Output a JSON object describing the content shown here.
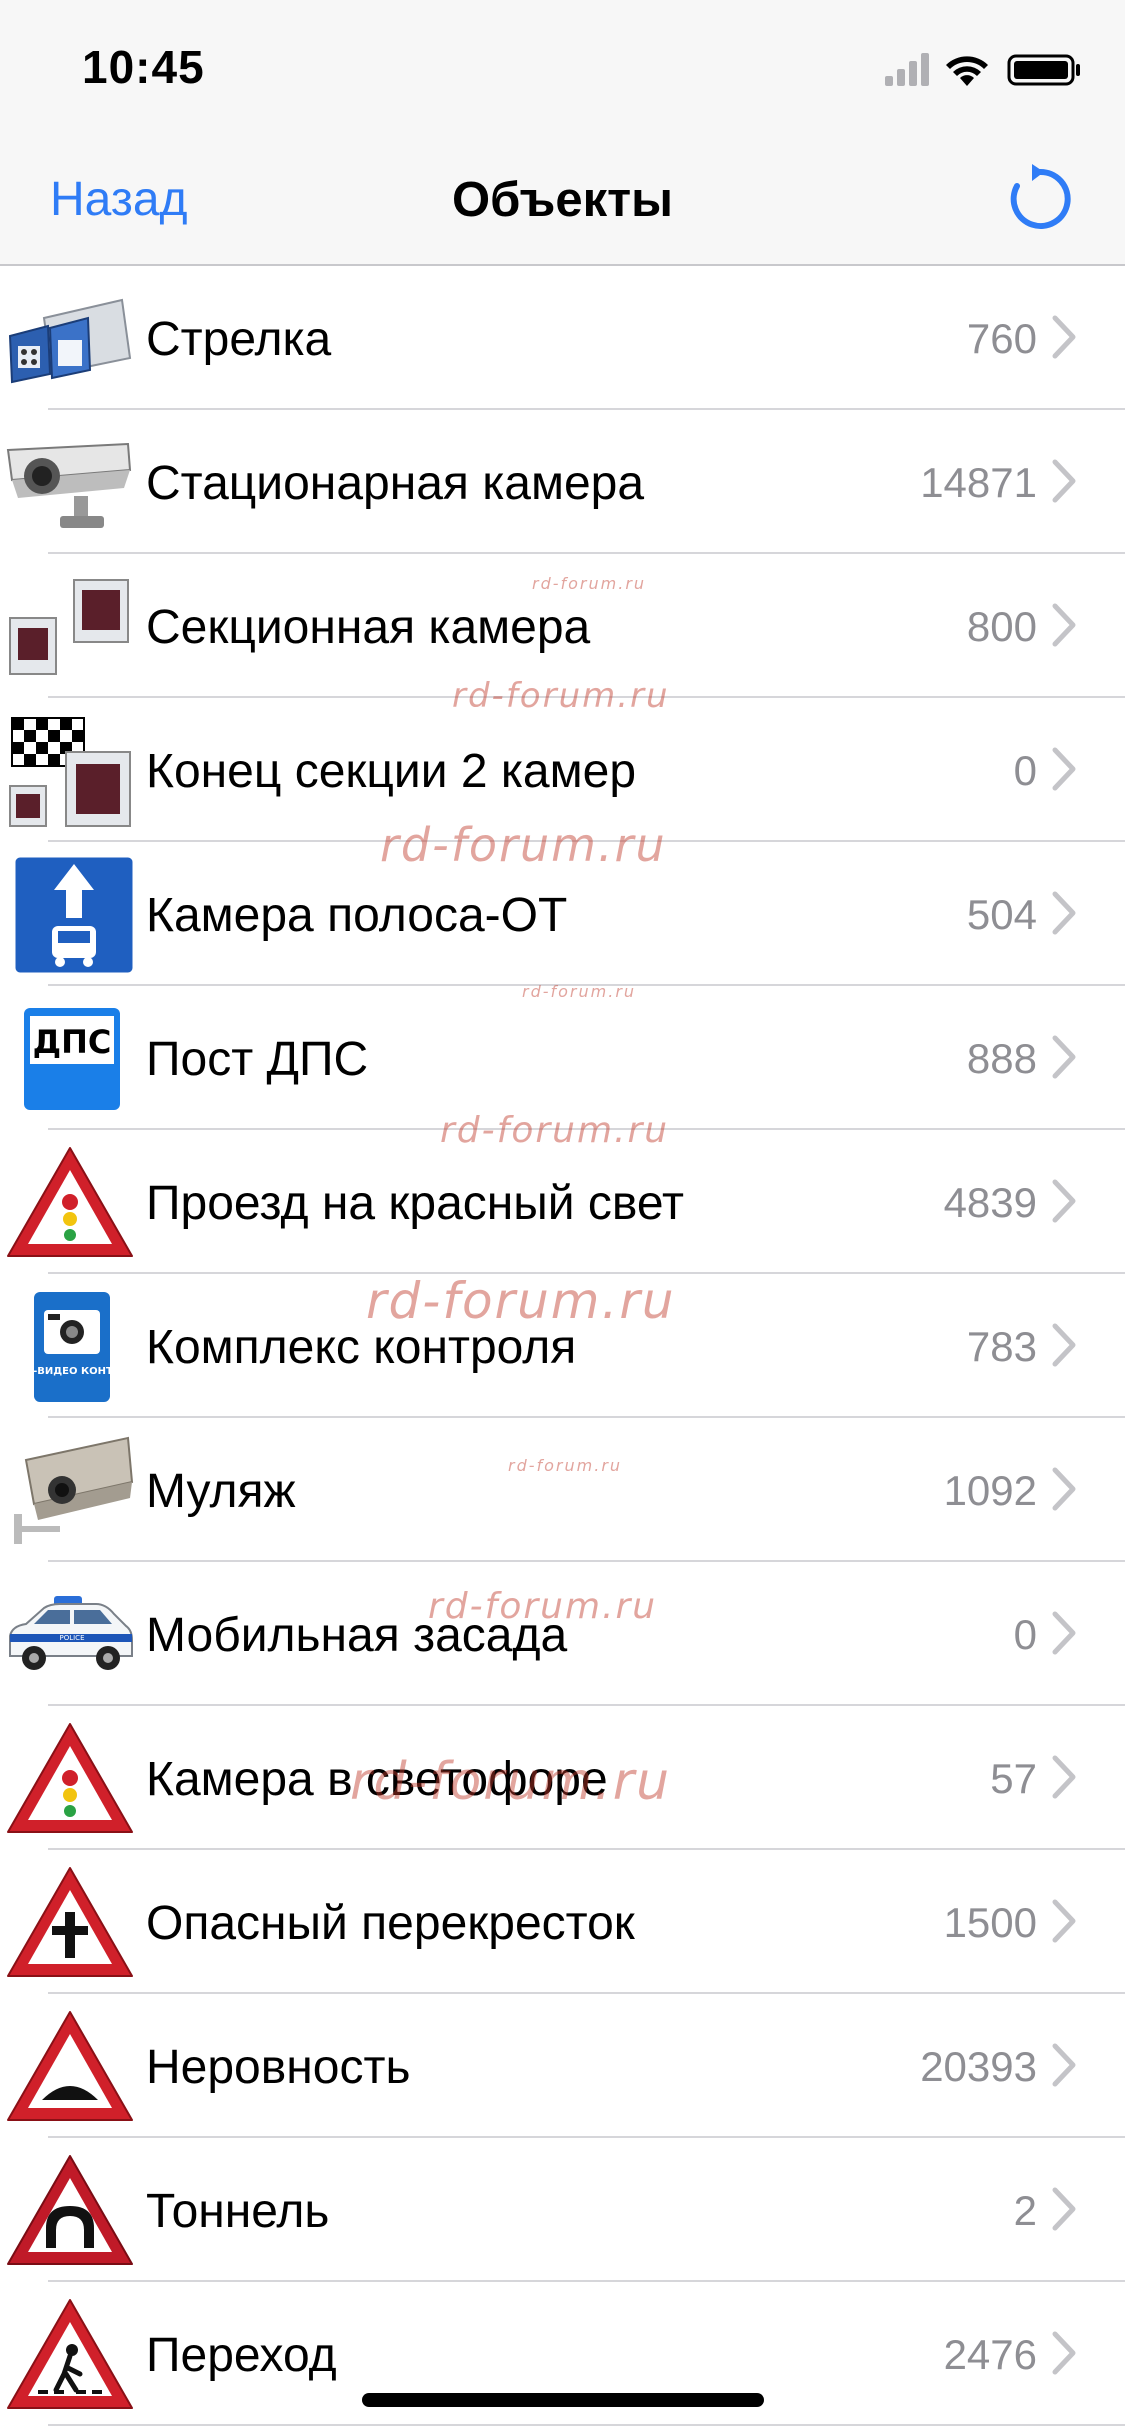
{
  "status": {
    "time": "10:45"
  },
  "nav": {
    "back_label": "Назад",
    "title": "Объекты"
  },
  "items": [
    {
      "label": "Стрелка",
      "count": "760",
      "icon": "strelka-camera-icon"
    },
    {
      "label": "Стационарная камера",
      "count": "14871",
      "icon": "stationary-camera-icon"
    },
    {
      "label": "Секционная камера",
      "count": "800",
      "icon": "section-camera-icon"
    },
    {
      "label": "Конец секции 2 камер",
      "count": "0",
      "icon": "section-end-flag-icon"
    },
    {
      "label": "Камера полоса-ОТ",
      "count": "504",
      "icon": "bus-lane-sign-icon"
    },
    {
      "label": "Пост ДПС",
      "count": "888",
      "icon": "dps-post-sign-icon",
      "icon_text": "ДПС"
    },
    {
      "label": "Проезд на красный свет",
      "count": "4839",
      "icon": "traffic-light-warning-icon"
    },
    {
      "label": "Комплекс контроля",
      "count": "783",
      "icon": "photo-video-control-sign-icon",
      "icon_text": "ФОТО-ВИДЕО КОНТРОЛЬ"
    },
    {
      "label": "Муляж",
      "count": "1092",
      "icon": "dummy-camera-icon"
    },
    {
      "label": "Мобильная засада",
      "count": "0",
      "icon": "police-car-icon",
      "icon_text": "POLICE"
    },
    {
      "label": "Камера в светофоре",
      "count": "57",
      "icon": "traffic-light-warning-icon"
    },
    {
      "label": "Опасный перекресток",
      "count": "1500",
      "icon": "intersection-warning-icon"
    },
    {
      "label": "Неровность",
      "count": "20393",
      "icon": "speed-bump-warning-icon"
    },
    {
      "label": "Тоннель",
      "count": "2",
      "icon": "tunnel-warning-icon"
    },
    {
      "label": "Переход",
      "count": "2476",
      "icon": "pedestrian-crossing-warning-icon"
    }
  ],
  "watermark": "rd-forum.ru",
  "colors": {
    "accent": "#2f7cf6",
    "count_gray": "#8e8e93",
    "warning_red": "#d0202a",
    "sign_blue": "#1f5fc0"
  }
}
